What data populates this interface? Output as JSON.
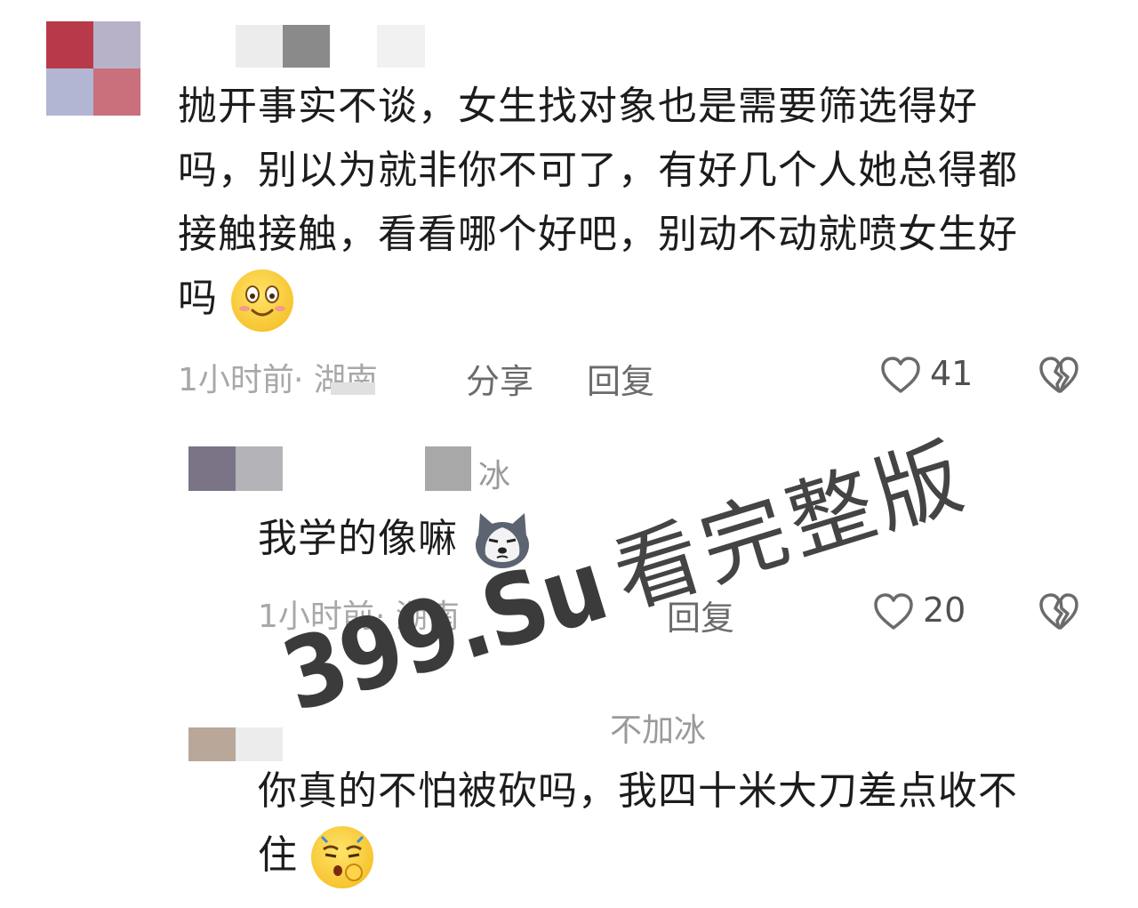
{
  "comments": [
    {
      "text_lines": [
        "抛开事实不谈，女生找对象也是需要筛选得好",
        "吗，别以为就非你不可了，有好几个人她总得都",
        "接触接触，看看哪个好吧，别动不动就喷女生好",
        "吗"
      ],
      "emoji": "blush-smile-emoji",
      "time": "1小时前",
      "location": "· 湖南",
      "share_label": "分享",
      "reply_label": "回复",
      "like_count": "41",
      "like_icon": "heart-icon",
      "dislike_icon": "broken-heart-icon"
    }
  ],
  "replies": [
    {
      "nick_fragment": "冰",
      "text": "我学的像嘛",
      "emoji": "husky-dog-emoji",
      "time": "1小时前",
      "location": "· 湖南",
      "reply_label": "回复",
      "like_count": "20"
    },
    {
      "nick_fragment": "不加冰",
      "text_lines": [
        "你真的不怕被砍吗，我四十米大刀差点收不",
        "住"
      ],
      "emoji": "sigh-emoji"
    }
  ],
  "watermark": {
    "site": "399.Su",
    "text": "看完整版"
  },
  "colors": {
    "text": "#1c1c1c",
    "meta": "#a8a8a8",
    "icon": "#6b6b6b"
  }
}
